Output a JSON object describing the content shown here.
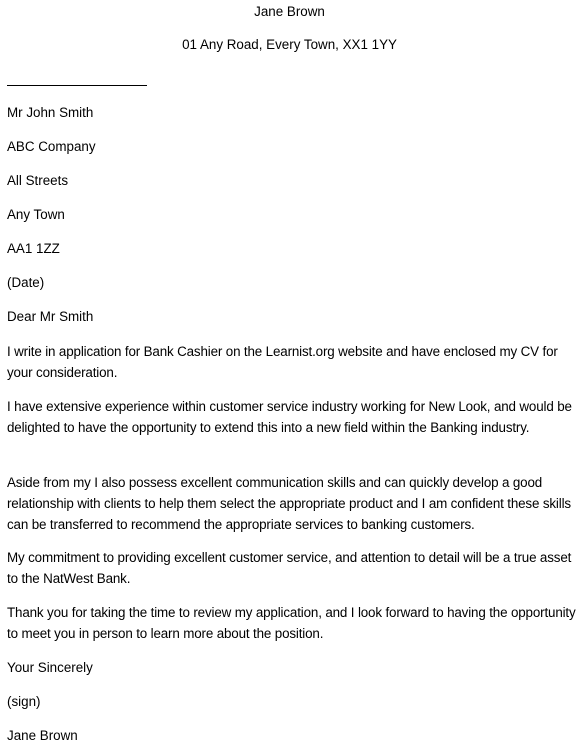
{
  "sender": {
    "name": "Jane Brown",
    "address": "01 Any Road, Every Town, XX1 1YY"
  },
  "recipient": {
    "name": "Mr John Smith",
    "company": "ABC Company",
    "street": "All Streets",
    "town": "Any Town",
    "postcode": "AA1 1ZZ"
  },
  "date": "(Date)",
  "salutation": "Dear Mr Smith",
  "paragraphs": [
    "I write in application for Bank Cashier on the Learnist.org website and have enclosed my CV for your consideration.",
    "I have extensive experience within customer service industry working for New Look, and would be delighted to have the opportunity to extend this into a new field within the Banking industry.",
    "Aside from my I also possess excellent communication skills and can quickly develop a good relationship with clients to help them select the appropriate product and I am confident these skills can be transferred to recommend the appropriate services to banking customers.",
    "My commitment to providing excellent customer service, and attention to detail will be a true asset to the NatWest Bank.",
    "Thank you for taking the time to review my application, and I look forward to having the opportunity to meet you in person to learn more about the position."
  ],
  "closing": "Your Sincerely",
  "signature": "(sign)",
  "signoff_name": "Jane Brown"
}
